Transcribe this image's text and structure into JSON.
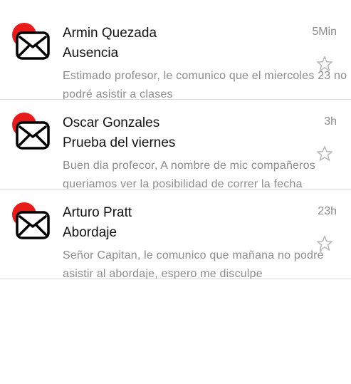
{
  "emails": [
    {
      "sender": "Armin Quezada",
      "subject": "Ausencia",
      "time": "5Min",
      "preview": "Estimado profesor, le comunico que el miercoles 23 no podré asistir a clases",
      "icon": "mail-icon",
      "star_icon": "star-outline-icon"
    },
    {
      "sender": "Oscar Gonzales",
      "subject": "Prueba del viernes",
      "time": "3h",
      "preview": "Buen dia profecor, A nombre de mic compañeros queriamos ver la posibilidad de correr la fecha",
      "icon": "mail-icon",
      "star_icon": "star-outline-icon"
    },
    {
      "sender": "Arturo Pratt",
      "subject": "Abordaje",
      "time": "23h",
      "preview": "Señor Capitan, le comunico que mañana no podré asistir al abordaje, espero me disculpe",
      "icon": "mail-icon",
      "star_icon": "star-outline-icon"
    }
  ],
  "colors": {
    "unread_dot": "#e81a1a",
    "text_primary": "#111111",
    "text_secondary": "#8c8c8c",
    "divider": "#d6d6d6"
  }
}
